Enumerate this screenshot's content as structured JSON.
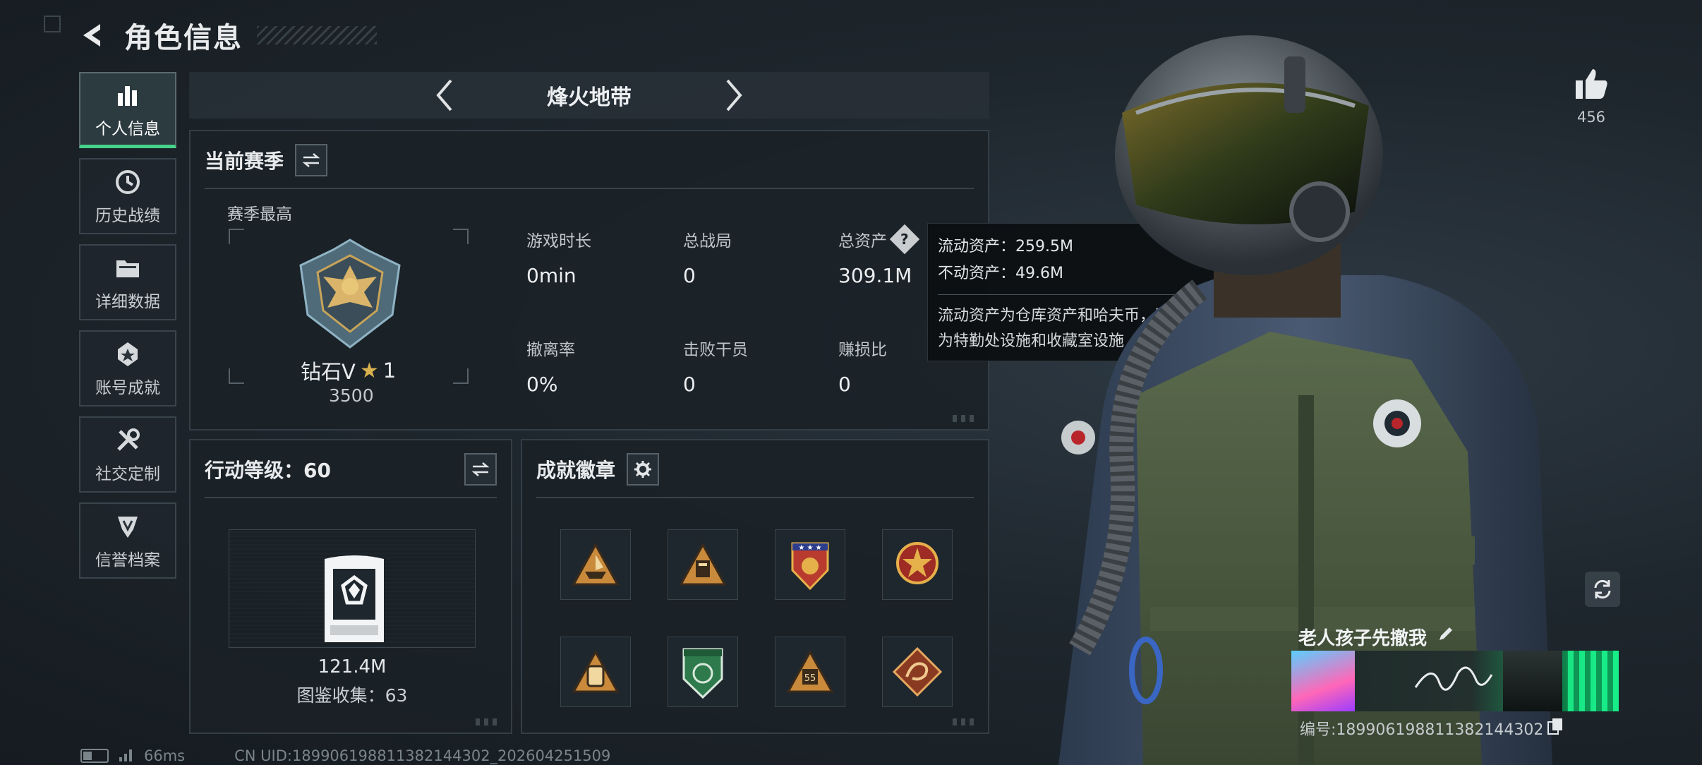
{
  "header": {
    "title": "角色信息"
  },
  "nav": {
    "items": [
      {
        "label": "个人信息",
        "icon": "bar-chart-icon",
        "active": true
      },
      {
        "label": "历史战绩",
        "icon": "history-clock-icon",
        "active": false
      },
      {
        "label": "详细数据",
        "icon": "folder-icon",
        "active": false
      },
      {
        "label": "账号成就",
        "icon": "achievement-icon",
        "active": false
      },
      {
        "label": "社交定制",
        "icon": "tools-icon",
        "active": false
      },
      {
        "label": "信誉档案",
        "icon": "credit-shield-icon",
        "active": false
      }
    ]
  },
  "mode": {
    "title": "烽火地带"
  },
  "season": {
    "title": "当前赛季",
    "best_label": "赛季最高",
    "rank_name": "钻石V",
    "rank_stars": "1",
    "rank_score": "3500",
    "stats": [
      {
        "label": "游戏时长",
        "value": "0min"
      },
      {
        "label": "总战局",
        "value": "0"
      },
      {
        "label": "总资产",
        "value": "309.1M"
      },
      {
        "label": "撤离率",
        "value": "0%"
      },
      {
        "label": "击败干员",
        "value": "0"
      },
      {
        "label": "赚损比",
        "value": "0"
      }
    ]
  },
  "tooltip": {
    "liquid": "流动资产：259.5M",
    "fixed": "不动资产：49.6M",
    "desc_line1": "流动资产为仓库资产和哈夫币，不动资产",
    "desc_line2": "为特勤处设施和收藏室设施"
  },
  "level": {
    "title": "行动等级：60",
    "value": "121.4M",
    "collect": "图鉴收集：63"
  },
  "badges": {
    "title": "成就徽章",
    "items": [
      "ship-badge-icon",
      "crate-badge-icon",
      "star-shield-badge-icon",
      "star-medal-badge-icon",
      "backpack-badge-icon",
      "green-shield-badge-icon",
      "ammo-badge-icon",
      "dragon-badge-icon"
    ]
  },
  "profile": {
    "likes": "456",
    "name": "老人孩子先撤我",
    "id": "编号:18990619881138214430​2"
  },
  "status": {
    "ping": "66ms",
    "uid": "CN UID:18990619881138214430​2_202604251509"
  },
  "colors": {
    "accent": "#46d38a",
    "banner_green": "#12e37e"
  }
}
